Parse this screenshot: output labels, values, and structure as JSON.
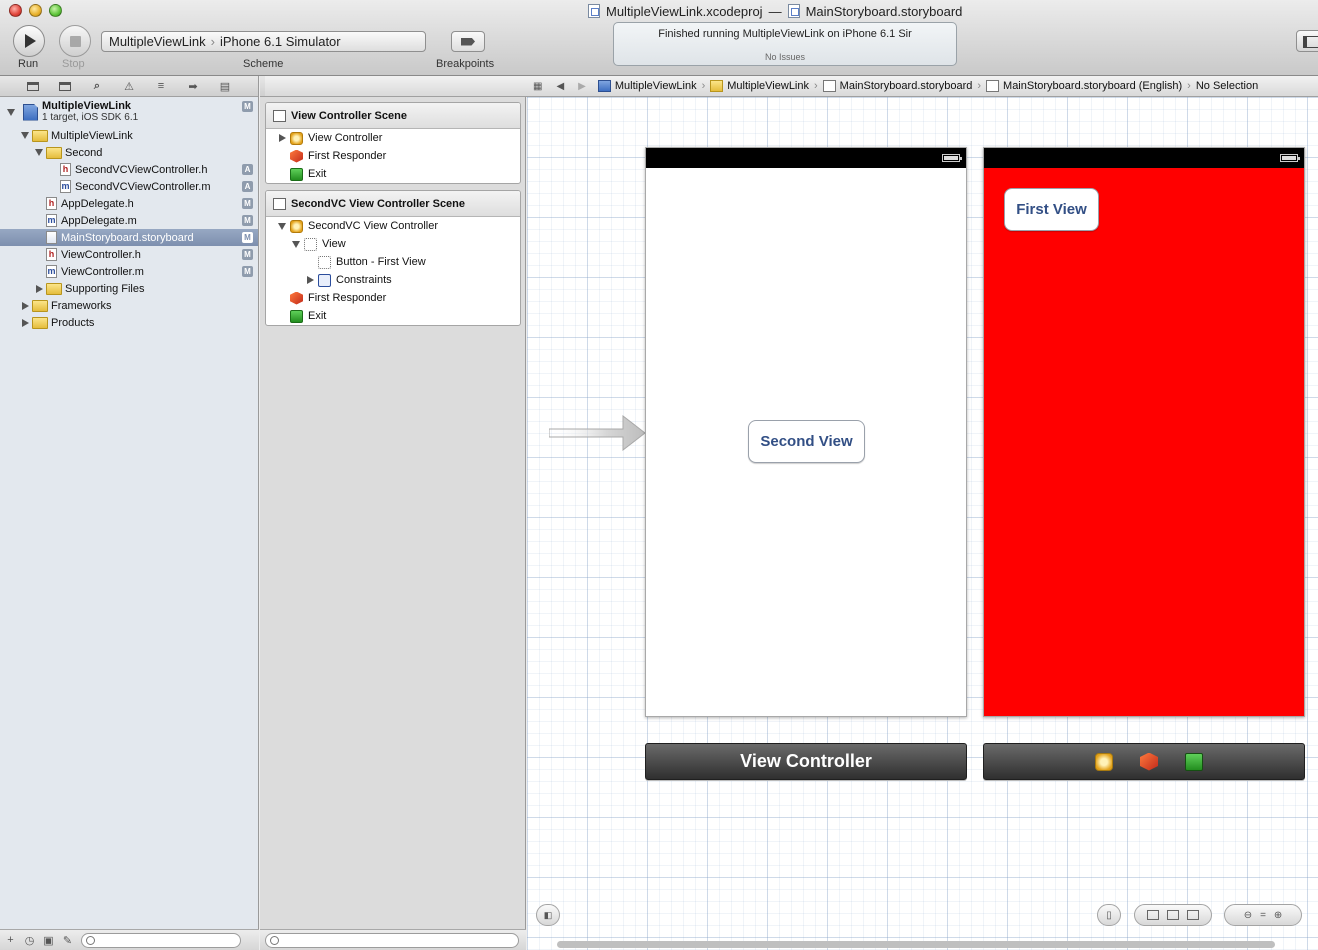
{
  "window": {
    "title_project": "MultipleViewLink.xcodeproj",
    "title_dash": "—",
    "title_file": "MainStoryboard.storyboard"
  },
  "toolbar": {
    "run_label": "Run",
    "stop_label": "Stop",
    "scheme_name": "MultipleViewLink",
    "scheme_sep": "›",
    "scheme_destination": "iPhone 6.1 Simulator",
    "scheme_label": "Scheme",
    "breakpoints_label": "Breakpoints",
    "activity_status": "Finished running MultipleViewLink on iPhone 6.1 Sir",
    "activity_issues": "No Issues"
  },
  "navigator": {
    "project_name": "MultipleViewLink",
    "project_subtitle": "1 target, iOS SDK 6.1",
    "project_badge": "M",
    "items": [
      {
        "label": "MultipleViewLink",
        "kind": "folder",
        "indent": 1,
        "disclosure": "open",
        "badge": ""
      },
      {
        "label": "Second",
        "kind": "folder",
        "indent": 2,
        "disclosure": "open",
        "badge": ""
      },
      {
        "label": "SecondVCViewController.h",
        "kind": "h",
        "indent": 3,
        "disclosure": "",
        "badge": "A"
      },
      {
        "label": "SecondVCViewController.m",
        "kind": "m",
        "indent": 3,
        "disclosure": "",
        "badge": "A"
      },
      {
        "label": "AppDelegate.h",
        "kind": "h",
        "indent": 2,
        "disclosure": "",
        "badge": "M"
      },
      {
        "label": "AppDelegate.m",
        "kind": "m",
        "indent": 2,
        "disclosure": "",
        "badge": "M"
      },
      {
        "label": "MainStoryboard.storyboard",
        "kind": "sb",
        "indent": 2,
        "disclosure": "",
        "badge": "M",
        "selected": true
      },
      {
        "label": "ViewController.h",
        "kind": "h",
        "indent": 2,
        "disclosure": "",
        "badge": "M"
      },
      {
        "label": "ViewController.m",
        "kind": "m",
        "indent": 2,
        "disclosure": "",
        "badge": "M"
      },
      {
        "label": "Supporting Files",
        "kind": "folder",
        "indent": 2,
        "disclosure": "closed",
        "badge": ""
      },
      {
        "label": "Frameworks",
        "kind": "folder",
        "indent": 1,
        "disclosure": "closed",
        "badge": ""
      },
      {
        "label": "Products",
        "kind": "folder",
        "indent": 1,
        "disclosure": "closed",
        "badge": ""
      }
    ]
  },
  "outline": {
    "scenes": [
      {
        "title": "View Controller Scene",
        "rows": [
          {
            "label": "View Controller",
            "icon": "vc",
            "indent": 0,
            "disclosure": "closed"
          },
          {
            "label": "First Responder",
            "icon": "fr",
            "indent": 0,
            "disclosure": ""
          },
          {
            "label": "Exit",
            "icon": "exit",
            "indent": 0,
            "disclosure": ""
          }
        ]
      },
      {
        "title": "SecondVC View Controller Scene",
        "rows": [
          {
            "label": "SecondVC View Controller",
            "icon": "vc",
            "indent": 0,
            "disclosure": "open"
          },
          {
            "label": "View",
            "icon": "view",
            "indent": 1,
            "disclosure": "open"
          },
          {
            "label": "Button - First View",
            "icon": "view",
            "indent": 2,
            "disclosure": ""
          },
          {
            "label": "Constraints",
            "icon": "cons",
            "indent": 2,
            "disclosure": "closed"
          },
          {
            "label": "First Responder",
            "icon": "fr",
            "indent": 0,
            "disclosure": ""
          },
          {
            "label": "Exit",
            "icon": "exit",
            "indent": 0,
            "disclosure": ""
          }
        ]
      }
    ]
  },
  "jumpbar": {
    "items": [
      {
        "label": "MultipleViewLink",
        "icon": "proj"
      },
      {
        "label": "MultipleViewLink",
        "icon": "fold"
      },
      {
        "label": "MainStoryboard.storyboard",
        "icon": "sb"
      },
      {
        "label": "MainStoryboard.storyboard (English)",
        "icon": "sb"
      },
      {
        "label": "No Selection",
        "icon": ""
      }
    ],
    "separator": "›"
  },
  "canvas": {
    "scene1_button": "Second View",
    "scene1_dock_label": "View Controller",
    "scene2_button": "First View",
    "scene2_background": "#ff0000"
  }
}
